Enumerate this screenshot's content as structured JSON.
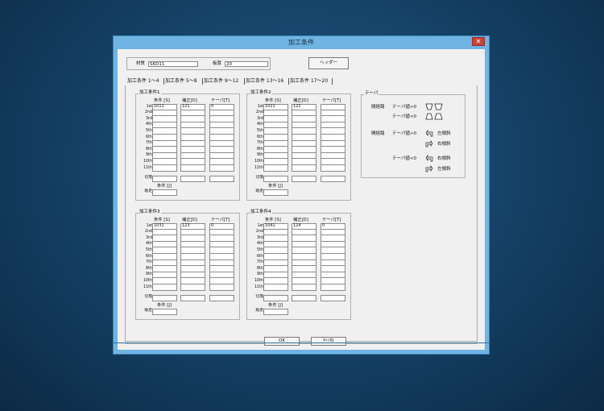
{
  "window": {
    "title": "加工条件",
    "close_label": "✕"
  },
  "header": {
    "material_label": "材質",
    "material_value": "SKD11",
    "thickness_label": "板厚",
    "thickness_value": "20",
    "header_button": "ヘッダー"
  },
  "tabs": [
    "加工条件 1〜4",
    "加工条件 5〜8",
    "加工条件 9〜12",
    "加工条件 13〜16",
    "加工条件 17〜20"
  ],
  "columns": {
    "s": "条件 [S]",
    "d": "補正[D]",
    "t": "テーパ[T]",
    "j": "条件 [J]"
  },
  "rows": [
    "1st",
    "2nd",
    "3rd",
    "4th",
    "5th",
    "6th",
    "7th",
    "8th",
    "9th",
    "10th",
    "11th"
  ],
  "cut_label": "切落",
  "assist_label": "助走",
  "groups": [
    {
      "title": "加工条件1",
      "s": "1011",
      "d": "121",
      "t": "0"
    },
    {
      "title": "加工条件2",
      "s": "1021",
      "d": "122",
      "t": ""
    },
    {
      "title": "加工条件3",
      "s": "1031",
      "d": "123",
      "t": "0"
    },
    {
      "title": "加工条件4",
      "s": "1041",
      "d": "124",
      "t": "0"
    }
  ],
  "taper": {
    "title": "テーパ",
    "closed_path": "閉経路",
    "open_path": "開経路",
    "taper_pos": "テーパ値>0",
    "taper_neg": "テーパ値<0",
    "left_slope": "左傾斜",
    "right_slope": "右傾斜"
  },
  "buttons": {
    "ok": "OK",
    "cancel": "ｷｬﾝｾﾙ"
  }
}
